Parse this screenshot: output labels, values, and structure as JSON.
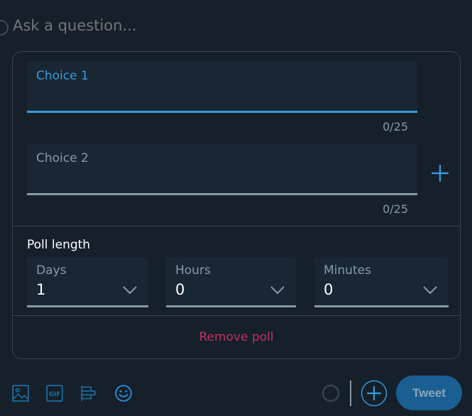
{
  "compose": {
    "question_placeholder": "Ask a question..."
  },
  "poll": {
    "choices": [
      {
        "placeholder": "Choice 1",
        "value": "",
        "counter": "0/25",
        "active": true
      },
      {
        "placeholder": "Choice 2",
        "value": "",
        "counter": "0/25",
        "active": false
      }
    ],
    "add_choice_icon": "plus-icon",
    "length_label": "Poll length",
    "length_fields": [
      {
        "label": "Days",
        "value": "1"
      },
      {
        "label": "Hours",
        "value": "0"
      },
      {
        "label": "Minutes",
        "value": "0"
      }
    ],
    "remove_label": "Remove poll"
  },
  "toolbar": {
    "icons": [
      "image-icon",
      "gif-icon",
      "poll-icon",
      "emoji-icon"
    ],
    "gif_text": "GIF",
    "tweet_label": "Tweet"
  },
  "colors": {
    "background": "#15202b",
    "field_bg": "#192734",
    "accent": "#3a9ad9",
    "muted": "#8899a6",
    "danger": "#c2305f",
    "border": "#38444d"
  }
}
